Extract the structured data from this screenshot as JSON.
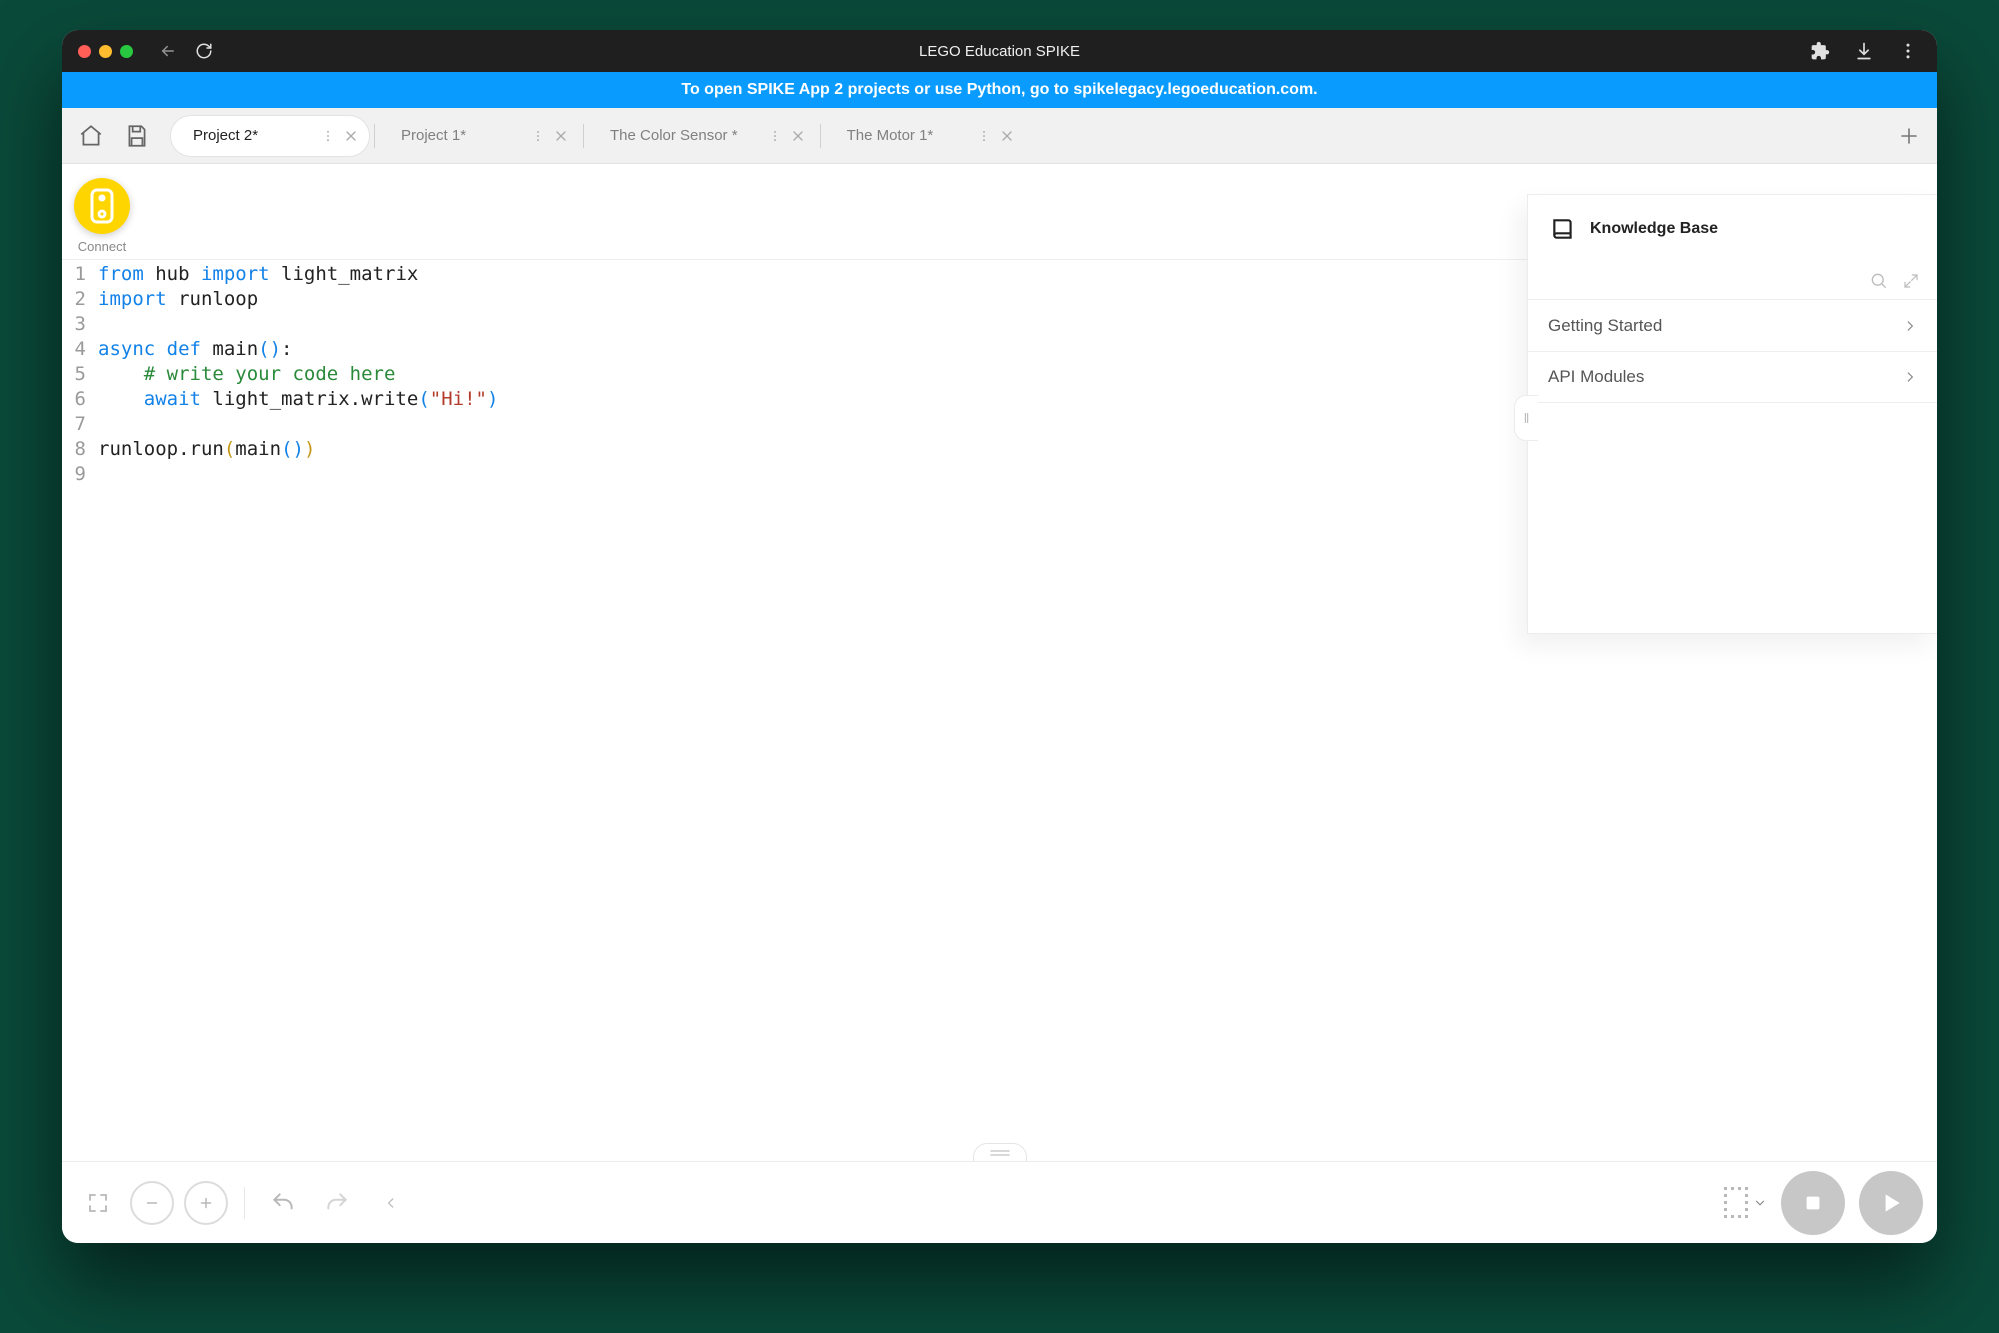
{
  "titlebar": {
    "title": "LEGO Education SPIKE"
  },
  "banner": {
    "text": "To open SPIKE App 2 projects or use Python, go to spikelegacy.legoeducation.com."
  },
  "tabs": [
    {
      "label": "Project 2*",
      "active": true
    },
    {
      "label": "Project 1*",
      "active": false
    },
    {
      "label": "The Color Sensor *",
      "active": false
    },
    {
      "label": "The Motor 1*",
      "active": false
    }
  ],
  "connect": {
    "label": "Connect"
  },
  "code_lines": [
    {
      "n": 1,
      "segments": [
        [
          "kw",
          "from"
        ],
        [
          "ident",
          " hub "
        ],
        [
          "kw",
          "import"
        ],
        [
          "ident",
          " light_matrix"
        ]
      ]
    },
    {
      "n": 2,
      "segments": [
        [
          "kw",
          "import"
        ],
        [
          "ident",
          " runloop"
        ]
      ]
    },
    {
      "n": 3,
      "segments": []
    },
    {
      "n": 4,
      "segments": [
        [
          "kw",
          "async def"
        ],
        [
          "ident",
          " main"
        ],
        [
          "paren",
          "()"
        ],
        [
          "ident",
          ":"
        ]
      ]
    },
    {
      "n": 5,
      "segments": [
        [
          "ident",
          "    "
        ],
        [
          "comment",
          "# write your code here"
        ]
      ]
    },
    {
      "n": 6,
      "segments": [
        [
          "ident",
          "    "
        ],
        [
          "kw",
          "await"
        ],
        [
          "ident",
          " light_matrix.write"
        ],
        [
          "paren",
          "("
        ],
        [
          "string",
          "\"Hi!\""
        ],
        [
          "paren",
          ")"
        ]
      ]
    },
    {
      "n": 7,
      "segments": []
    },
    {
      "n": 8,
      "segments": [
        [
          "ident",
          "runloop.run"
        ],
        [
          "paren-gold",
          "("
        ],
        [
          "ident",
          "main"
        ],
        [
          "paren",
          "()"
        ],
        [
          "paren-gold",
          ")"
        ]
      ]
    },
    {
      "n": 9,
      "segments": []
    }
  ],
  "knowledge_base": {
    "title": "Knowledge Base",
    "items": [
      "Getting Started",
      "API Modules"
    ]
  }
}
